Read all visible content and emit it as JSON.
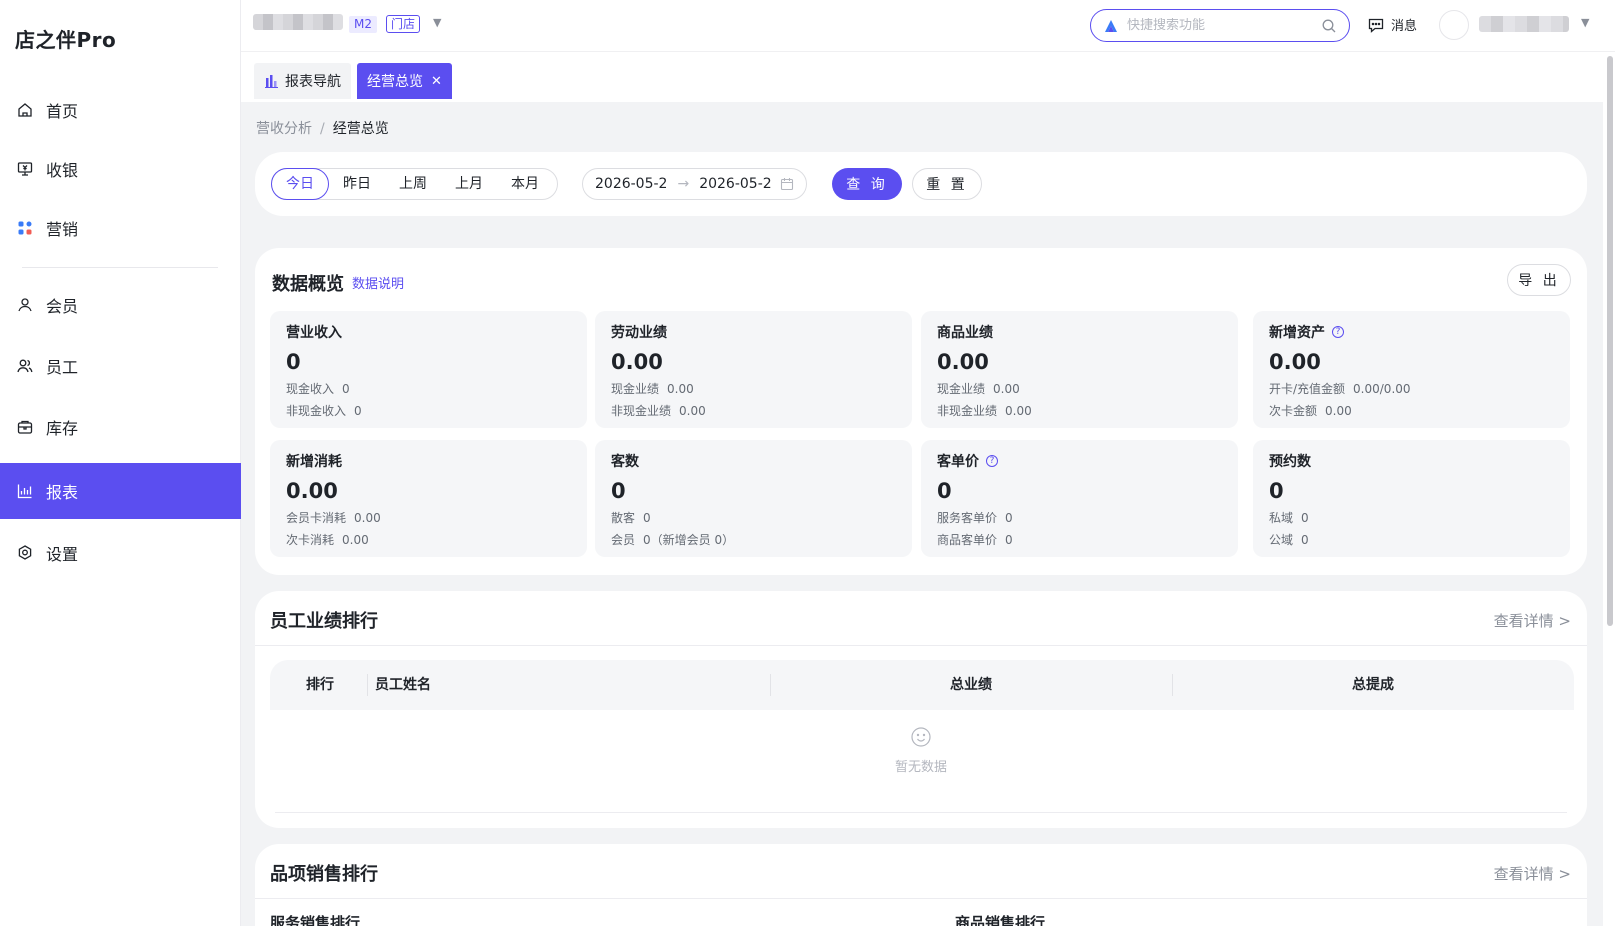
{
  "app": {
    "logo": "店之伴Pro"
  },
  "sidebar": {
    "items": [
      {
        "label": "首页",
        "icon": "home-icon"
      },
      {
        "label": "收银",
        "icon": "cashier-icon"
      },
      {
        "label": "营销",
        "icon": "marketing-icon"
      },
      {
        "label": "会员",
        "icon": "member-icon"
      },
      {
        "label": "员工",
        "icon": "staff-icon"
      },
      {
        "label": "库存",
        "icon": "inventory-icon"
      },
      {
        "label": "报表",
        "icon": "report-icon",
        "active": true
      },
      {
        "label": "设置",
        "icon": "settings-icon"
      }
    ]
  },
  "header": {
    "version_tag": "M2",
    "store_tag": "门店",
    "search_placeholder": "快捷搜索功能",
    "message_label": "消息"
  },
  "tabs": [
    {
      "label": "报表导航"
    },
    {
      "label": "经营总览",
      "active": true
    }
  ],
  "breadcrumb": {
    "parent": "营收分析",
    "separator": "/",
    "current": "经营总览"
  },
  "filter": {
    "periods": [
      "今日",
      "昨日",
      "上周",
      "上月",
      "本月"
    ],
    "active_period": "今日",
    "date_start": "2026-05-2",
    "date_end": "2026-05-2",
    "date_arrow": "→",
    "query_label": "查 询",
    "reset_label": "重 置"
  },
  "overview": {
    "title": "数据概览",
    "explain_link": "数据说明",
    "export_label": "导 出",
    "metrics": [
      {
        "label": "营业收入",
        "value": "0",
        "subs": [
          [
            "现金收入",
            "0"
          ],
          [
            "非现金收入",
            "0"
          ]
        ]
      },
      {
        "label": "劳动业绩",
        "value": "0.00",
        "subs": [
          [
            "现金业绩",
            "0.00"
          ],
          [
            "非现金业绩",
            "0.00"
          ]
        ]
      },
      {
        "label": "商品业绩",
        "value": "0.00",
        "subs": [
          [
            "现金业绩",
            "0.00"
          ],
          [
            "非现金业绩",
            "0.00"
          ]
        ]
      },
      {
        "label": "新增资产",
        "value": "0.00",
        "help": "?",
        "subs": [
          [
            "开卡/充值金额",
            "0.00/0.00"
          ],
          [
            "次卡金额",
            "0.00"
          ]
        ]
      },
      {
        "label": "新增消耗",
        "value": "0.00",
        "subs": [
          [
            "会员卡消耗",
            "0.00"
          ],
          [
            "次卡消耗",
            "0.00"
          ]
        ]
      },
      {
        "label": "客数",
        "value": "0",
        "subs": [
          [
            "散客",
            "0"
          ],
          [
            "会员",
            "0（新增会员 0）"
          ]
        ]
      },
      {
        "label": "客单价",
        "value": "0",
        "help": "?",
        "subs": [
          [
            "服务客单价",
            "0"
          ],
          [
            "商品客单价",
            "0"
          ]
        ]
      },
      {
        "label": "预约数",
        "value": "0",
        "subs": [
          [
            "私域",
            "0"
          ],
          [
            "公域",
            "0"
          ]
        ]
      }
    ]
  },
  "employee_ranking": {
    "title": "员工业绩排行",
    "more_label": "查看详情 >",
    "columns": [
      "排行",
      "员工姓名",
      "总业绩",
      "总提成"
    ],
    "empty_text": "暂无数据"
  },
  "sales_ranking": {
    "title": "品项销售排行",
    "more_label": "查看详情 >",
    "service_title": "服务销售排行",
    "product_title": "商品销售排行"
  },
  "colors": {
    "accent": "#5b4ef0",
    "background": "#f2f3f5"
  }
}
